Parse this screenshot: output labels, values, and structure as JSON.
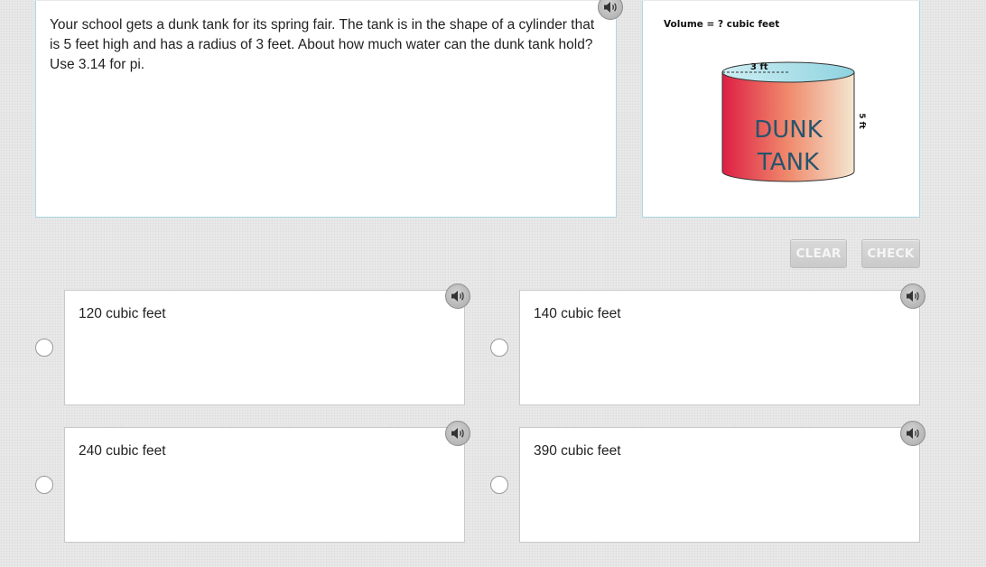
{
  "question": {
    "text": "Your school gets a dunk tank for its spring fair. The tank is in the shape of a cylinder that is 5 feet high and has a radius of 3 feet. About how much water can the dunk tank hold? Use 3.14 for pi.",
    "audio_icon": "speaker-icon"
  },
  "figure": {
    "caption": "Volume = ? cubic feet",
    "radius_label": "3 ft",
    "height_label": "5 ft",
    "tank_line1": "DUNK",
    "tank_line2": "TANK",
    "colors": {
      "tank_left": "#dd1f44",
      "tank_mid": "#f08a6c",
      "tank_right": "#f3e6cf",
      "water_top": "#9fdbe6",
      "tank_text": "#27546c"
    }
  },
  "buttons": {
    "clear_label": "CLEAR",
    "check_label": "CHECK"
  },
  "options": [
    {
      "label": "120 cubic feet",
      "selected": false
    },
    {
      "label": "140 cubic feet",
      "selected": false
    },
    {
      "label": "240 cubic feet",
      "selected": false
    },
    {
      "label": "390 cubic feet",
      "selected": false
    }
  ]
}
